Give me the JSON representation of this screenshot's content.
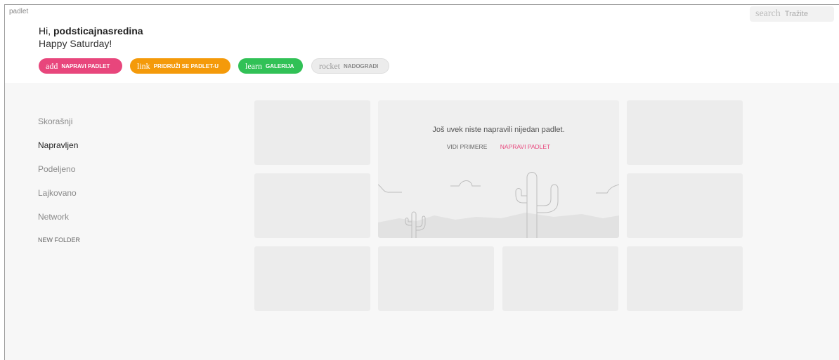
{
  "app": {
    "logo": "padlet"
  },
  "search": {
    "icon": "search",
    "placeholder": "Tražite"
  },
  "greeting": {
    "hi": "Hi, ",
    "username": "podsticajnasredina",
    "subtitle": "Happy Saturday!"
  },
  "actions": [
    {
      "icon": "add",
      "label": "NAPRAVI PADLET",
      "color": "#e8467c"
    },
    {
      "icon": "link",
      "label": "PRIDRUŽI SE PADLET-U",
      "color": "#f49a0a"
    },
    {
      "icon": "learn",
      "label": "GALERIJA",
      "color": "#31c156"
    },
    {
      "icon": "rocket",
      "label": "NADOGRADI",
      "color": "#ececec"
    }
  ],
  "sidebar": {
    "items": [
      {
        "label": "Skorašnji"
      },
      {
        "label": "Napravljen"
      },
      {
        "label": "Podeljeno"
      },
      {
        "label": "Lajkovano"
      },
      {
        "label": "Network"
      }
    ],
    "new_folder": "NEW FOLDER"
  },
  "empty_state": {
    "message": "Još uvek niste napravili nijedan padlet.",
    "see_examples": "VIDI PRIMERE",
    "create": "NAPRAVI PADLET"
  }
}
